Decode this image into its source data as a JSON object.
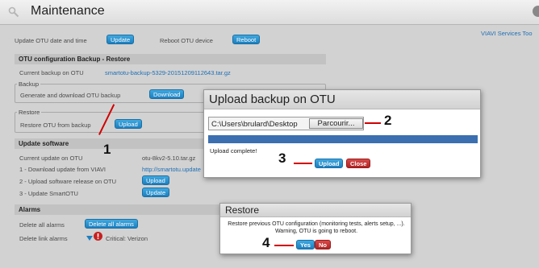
{
  "window": {
    "title": "Maintenance"
  },
  "services_link": "VIAVI Services Too",
  "top_bar": {
    "update_datetime_label": "Update OTU date and time",
    "update_btn": "Update",
    "reboot_label": "Reboot OTU device",
    "reboot_btn": "Reboot"
  },
  "config_section": {
    "title": "OTU configuration Backup - Restore",
    "current_backup_label": "Current backup on OTU",
    "current_backup_file": "smartotu-backup-5329-20151209112643.tar.gz",
    "backup_legend": "Backup",
    "backup_text": "Generate and download OTU backup",
    "download_btn": "Download",
    "restore_legend": "Restore",
    "restore_text": "Restore OTU from backup",
    "upload_btn": "Upload"
  },
  "software_section": {
    "title": "Update software",
    "current_update_label": "Current update on OTU",
    "current_update_value": "otu-8kv2-5.10.tar.gz",
    "step1_label": "1 - Download update from VIAVI",
    "step1_link": "http://smartotu.update",
    "step2_label": "2 - Upload software release on OTU",
    "step2_btn": "Upload",
    "step3_label": "3 - Update SmartOTU",
    "step3_btn": "Update"
  },
  "alarms_section": {
    "title": "Alarms",
    "delete_all_label": "Delete all alarms",
    "delete_all_btn": "Delete all alarms",
    "delete_link_label": "Delete link alarms",
    "critical_label": "Critical:",
    "critical_value": "Verizon"
  },
  "upload_dialog": {
    "title": "Upload backup on OTU",
    "file_path": "C:\\Users\\brulard\\Desktop",
    "browse_btn": "Parcourir...",
    "status": "Upload complete!",
    "upload_btn": "Upload",
    "close_btn": "Close"
  },
  "restore_dialog": {
    "title": "Restore",
    "message": "Restore previous OTU configuration (monitoring tests, alerts setup, ...). Warning, OTU is going to reboot.",
    "yes_btn": "Yes",
    "no_btn": "No"
  },
  "annotations": {
    "n1": "1",
    "n2": "2",
    "n3": "3",
    "n4": "4"
  },
  "colors": {
    "accent_blue": "#1c7fbf",
    "danger_red": "#b02424",
    "annotation_red": "#d10000",
    "progress_blue": "#3b6fb0"
  }
}
